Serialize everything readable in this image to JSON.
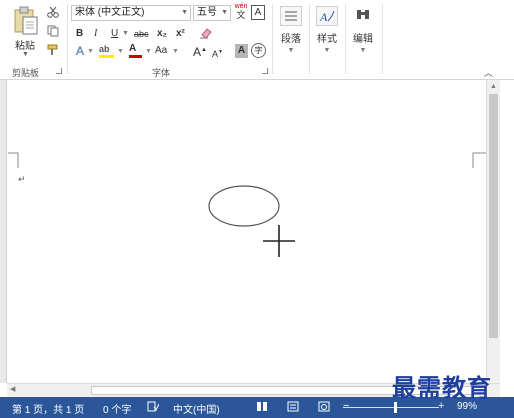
{
  "ribbon": {
    "clipboard": {
      "paste_label": "粘贴",
      "group_label": "剪贴板"
    },
    "font": {
      "font_name": "宋体 (中文正文)",
      "font_size": "五号",
      "phonetic_top": "wén",
      "phonetic_bottom": "文",
      "border_char": "A",
      "bold": "B",
      "italic": "I",
      "underline": "U",
      "strike": "abc",
      "subscript": "x₂",
      "superscript": "x²",
      "text_effect": "A",
      "highlight": "ab",
      "font_color": "A",
      "change_case": "Aa",
      "grow": "A",
      "shrink": "A",
      "shading_char": "A",
      "enclose_char": "字",
      "group_label": "字体"
    },
    "paragraph": {
      "label": "段落"
    },
    "styles": {
      "label": "样式"
    },
    "editing": {
      "label": "编辑"
    }
  },
  "document": {
    "paragraph_mark": "↵"
  },
  "statusbar": {
    "page": "第 1 页，共 1 页",
    "words": "0 个字",
    "language": "中文(中国)",
    "zoom": "99%",
    "zoom_level_percent": 99
  },
  "watermark": "最需教育",
  "colors": {
    "statusbar": "#2b579a",
    "highlight": "#ffee00",
    "font_color": "#d00000",
    "watermark": "#1f3f9e"
  }
}
